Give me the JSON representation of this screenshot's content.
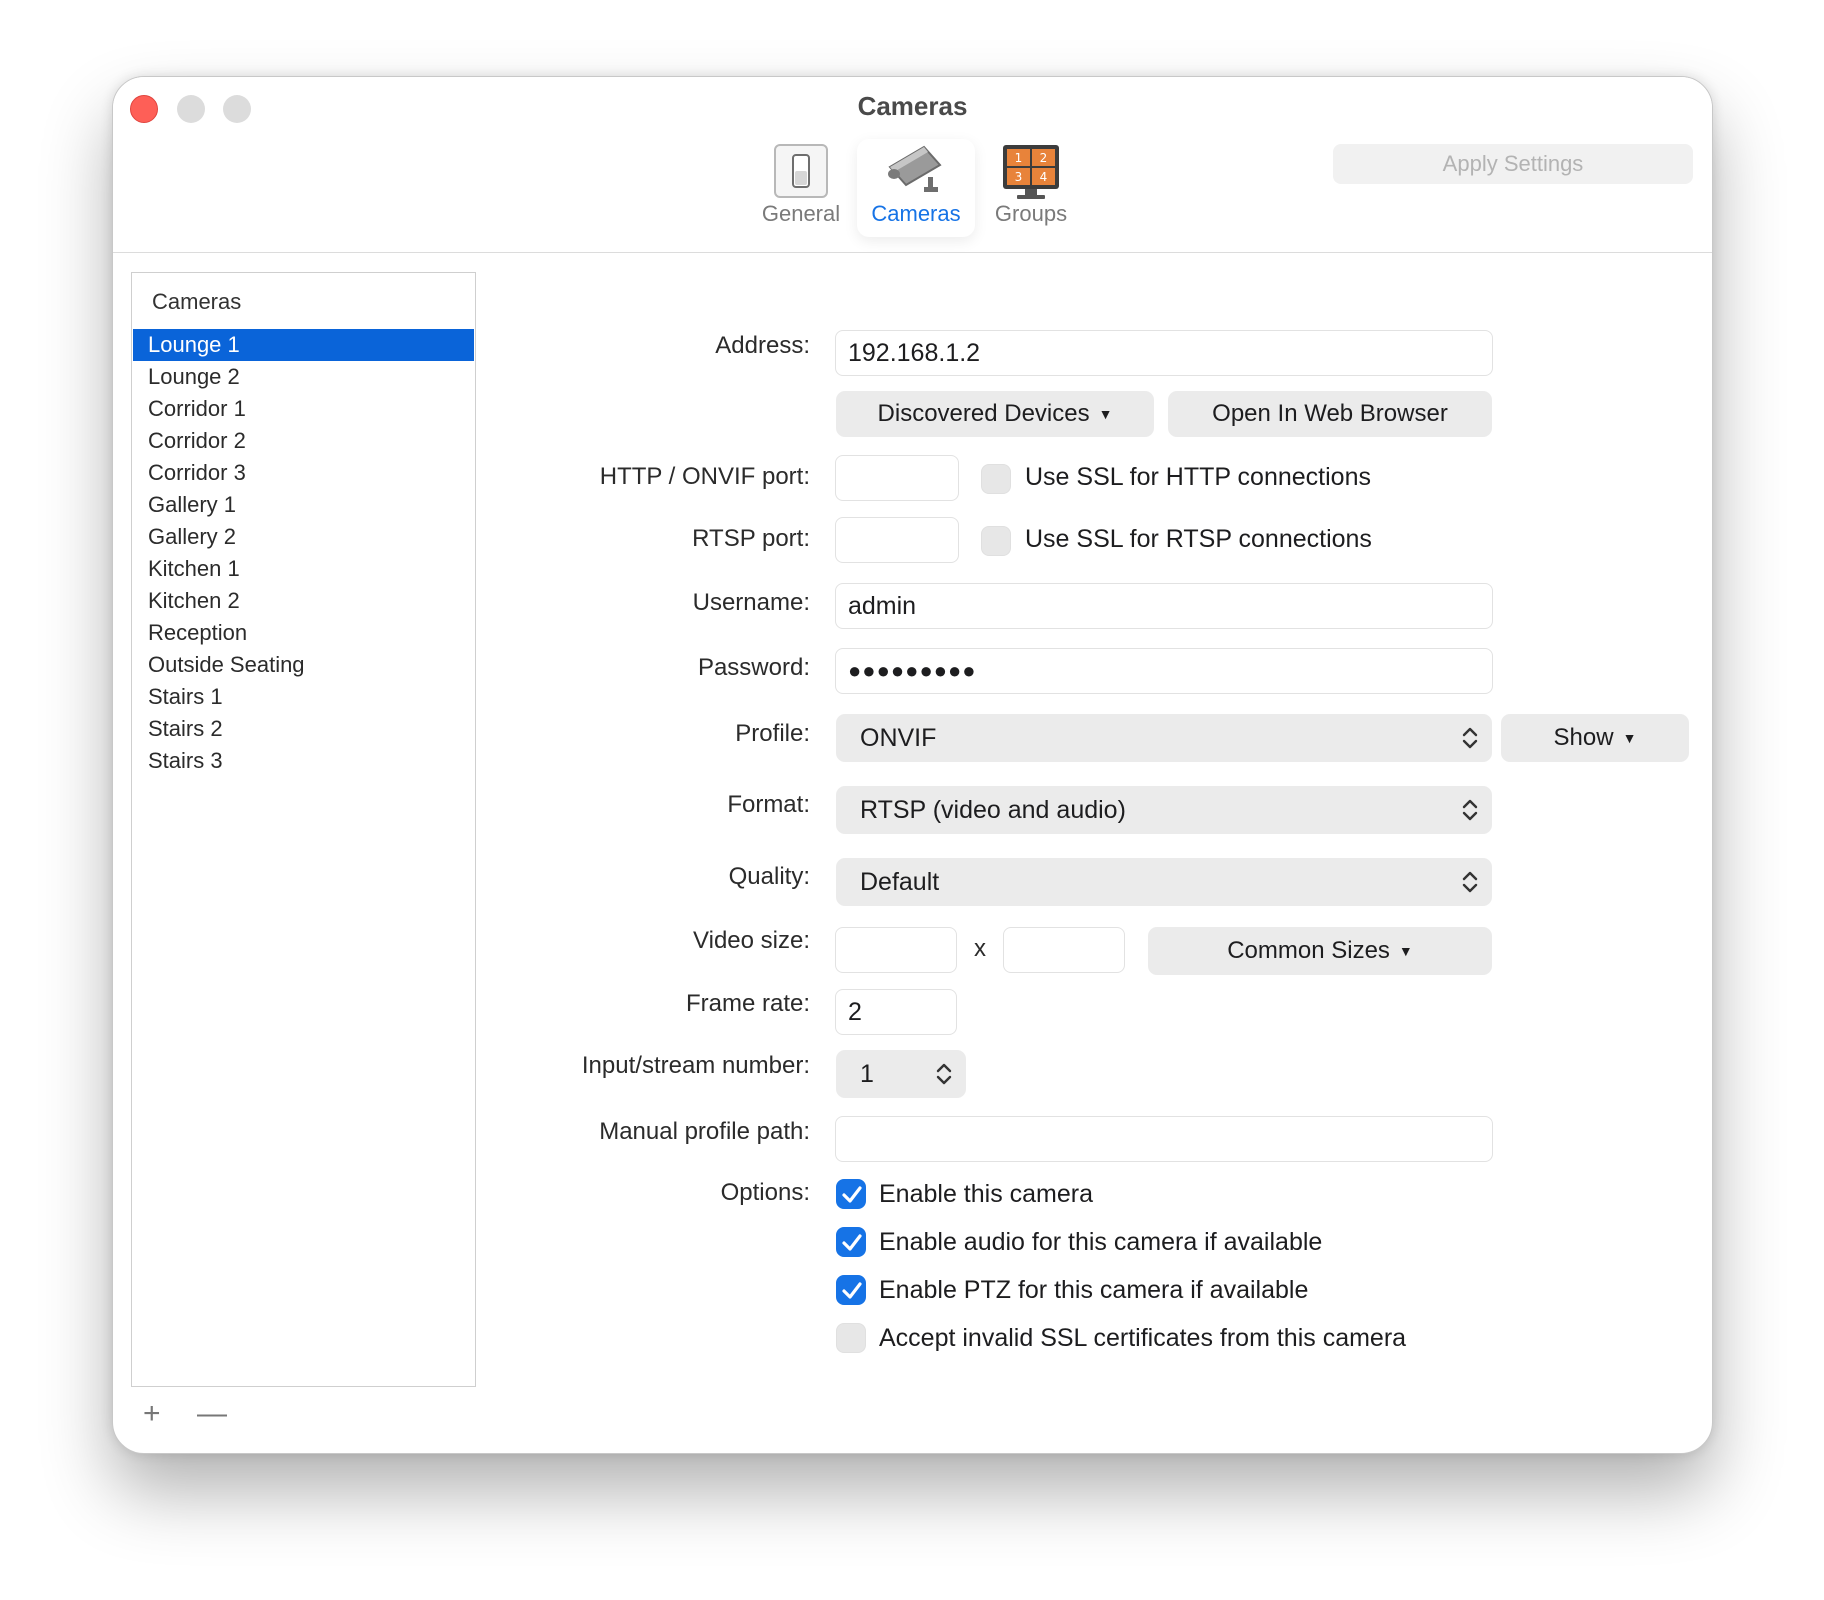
{
  "window": {
    "title": "Cameras"
  },
  "toolbar": {
    "items": [
      {
        "label": "General",
        "icon": "switch-icon"
      },
      {
        "label": "Cameras",
        "icon": "security-camera-icon"
      },
      {
        "label": "Groups",
        "icon": "grid-monitor-icon"
      }
    ],
    "active": "Cameras",
    "apply_label": "Apply Settings",
    "groups_icon_digits": [
      "1",
      "2",
      "3",
      "4"
    ]
  },
  "sidebar": {
    "header": "Cameras",
    "items": [
      "Lounge 1",
      "Lounge 2",
      "Corridor 1",
      "Corridor 2",
      "Corridor 3",
      "Gallery 1",
      "Gallery 2",
      "Kitchen 1",
      "Kitchen 2",
      "Reception",
      "Outside Seating",
      "Stairs 1",
      "Stairs 2",
      "Stairs 3"
    ],
    "selected": "Lounge 1",
    "add_label": "+",
    "remove_label": "—"
  },
  "form": {
    "address": {
      "label": "Address:",
      "value": "192.168.1.2"
    },
    "discovered_label": "Discovered Devices",
    "open_browser_label": "Open In Web Browser",
    "http_port": {
      "label": "HTTP / ONVIF port:",
      "value": "",
      "ssl_label": "Use SSL for HTTP connections",
      "ssl_checked": false
    },
    "rtsp_port": {
      "label": "RTSP port:",
      "value": "",
      "ssl_label": "Use SSL for RTSP connections",
      "ssl_checked": false
    },
    "username": {
      "label": "Username:",
      "value": "admin"
    },
    "password": {
      "label": "Password:",
      "value": "●●●●●●●●●"
    },
    "profile": {
      "label": "Profile:",
      "value": "ONVIF",
      "show_label": "Show"
    },
    "format": {
      "label": "Format:",
      "value": "RTSP (video and audio)"
    },
    "quality": {
      "label": "Quality:",
      "value": "Default"
    },
    "video_size": {
      "label": "Video size:",
      "width": "",
      "height": "",
      "separator": "x",
      "common_label": "Common Sizes"
    },
    "frame_rate": {
      "label": "Frame rate:",
      "value": "2"
    },
    "input_stream": {
      "label": "Input/stream number:",
      "value": "1"
    },
    "manual_path": {
      "label": "Manual profile path:",
      "value": ""
    },
    "options": {
      "label": "Options:",
      "items": [
        {
          "label": "Enable this camera",
          "checked": true
        },
        {
          "label": "Enable audio for this camera if available",
          "checked": true
        },
        {
          "label": "Enable PTZ for this camera if available",
          "checked": true
        },
        {
          "label": "Accept invalid SSL certificates from this camera",
          "checked": false
        }
      ]
    }
  },
  "colors": {
    "accent": "#1673e6",
    "selection": "#0a64d9",
    "close": "#fe5f57",
    "groups_icon": "#e8833a"
  }
}
